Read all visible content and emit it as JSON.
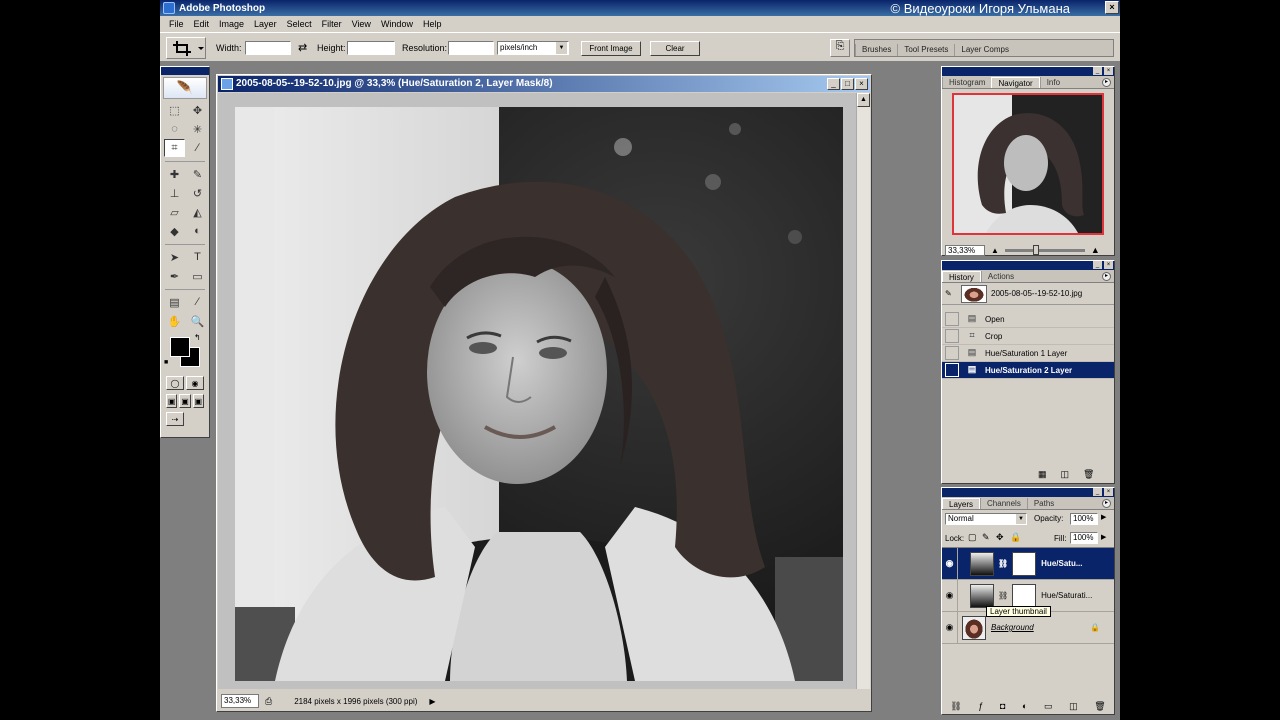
{
  "window": {
    "title": "Adobe Photoshop",
    "watermark": "© Видеоуроки Игоря Ульмана",
    "close": "×"
  },
  "menu": [
    "File",
    "Edit",
    "Image",
    "Layer",
    "Select",
    "Filter",
    "View",
    "Window",
    "Help"
  ],
  "options": {
    "width_label": "Width:",
    "width_value": "",
    "height_label": "Height:",
    "height_value": "",
    "resolution_label": "Resolution:",
    "resolution_value": "",
    "units": "pixels/inch",
    "front_image": "Front Image",
    "clear": "Clear",
    "well_tabs": [
      "Brushes",
      "Tool Presets",
      "Layer Comps"
    ]
  },
  "document": {
    "title": "2005-08-05--19-52-10.jpg @ 33,3% (Hue/Saturation 2, Layer Mask/8)",
    "zoom": "33,33%",
    "info": "2184 pixels x 1996 pixels (300 ppi)"
  },
  "navigator": {
    "tabs": [
      "Histogram",
      "Navigator",
      "Info"
    ],
    "active_tab": "Navigator",
    "zoom": "33,33%"
  },
  "history": {
    "tabs": [
      "History",
      "Actions"
    ],
    "snapshot": "2005-08-05--19-52-10.jpg",
    "items": [
      {
        "label": "Open",
        "icon": "document-icon"
      },
      {
        "label": "Crop",
        "icon": "crop-icon"
      },
      {
        "label": "Hue/Saturation 1 Layer",
        "icon": "adjustment-icon"
      },
      {
        "label": "Hue/Saturation 2 Layer",
        "icon": "adjustment-icon",
        "selected": true
      }
    ]
  },
  "layers": {
    "tabs": [
      "Layers",
      "Channels",
      "Paths"
    ],
    "blend_mode": "Normal",
    "opacity_label": "Opacity:",
    "opacity": "100%",
    "lock_label": "Lock:",
    "fill_label": "Fill:",
    "fill": "100%",
    "items": [
      {
        "name": "Hue/Satu...",
        "selected": true
      },
      {
        "name": "Hue/Saturati...",
        "selected": false
      },
      {
        "name": "Background",
        "selected": false
      }
    ],
    "tooltip": "Layer thumbnail"
  },
  "colors": {
    "titlebar": "#0a246a",
    "chrome": "#d4d0c8",
    "selection": "#0a246a",
    "nav_frame": "#e0333a"
  }
}
